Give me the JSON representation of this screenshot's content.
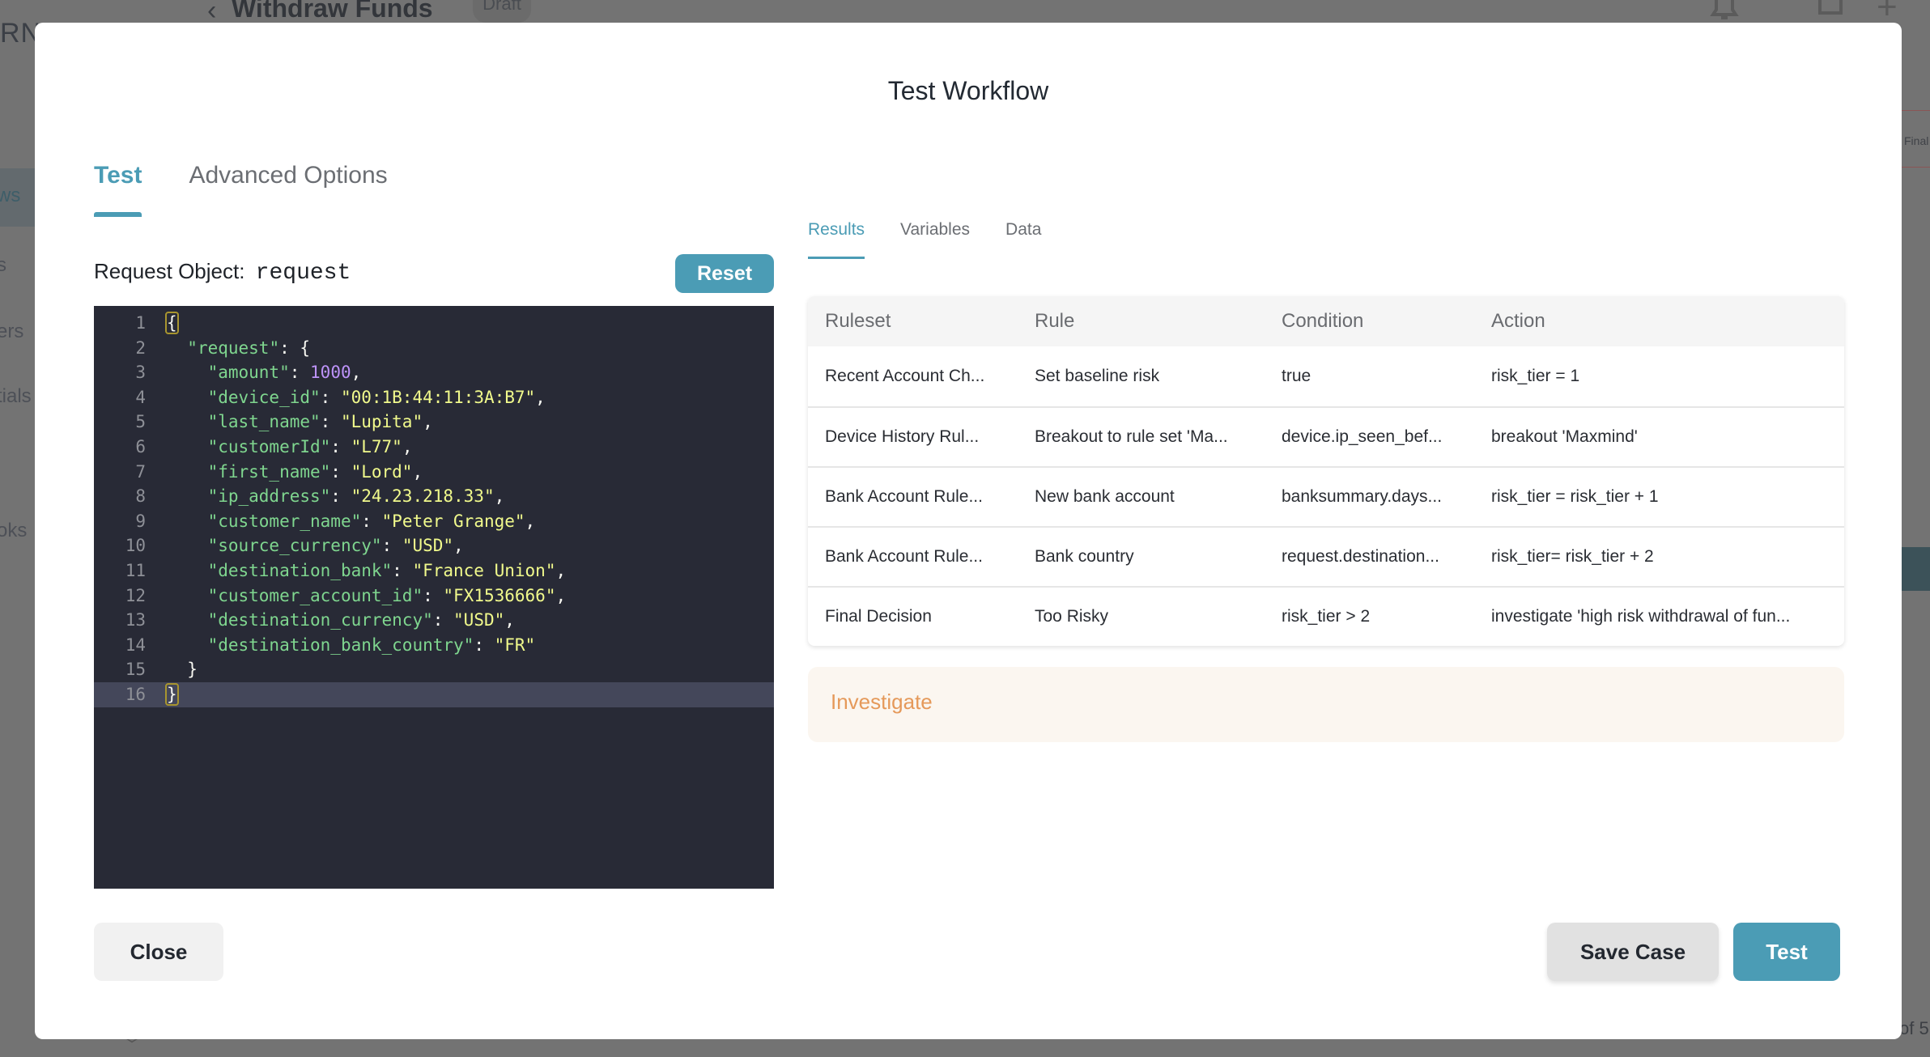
{
  "background": {
    "page_title": "Withdraw Funds",
    "status_badge": "Draft",
    "logo_fragment": "RN",
    "sidebar_fragments": [
      "ws",
      "s",
      "ers",
      "tials",
      "oks"
    ],
    "right_fragment": "Final",
    "pagination_fragment": "of 5"
  },
  "modal": {
    "title": "Test Workflow",
    "tabs": [
      {
        "label": "Test",
        "active": true
      },
      {
        "label": "Advanced Options",
        "active": false
      }
    ],
    "request": {
      "label": "Request Object:",
      "object_name": "request",
      "reset_label": "Reset"
    },
    "editor": {
      "active_line": 16,
      "lines": [
        {
          "num": "1",
          "indent": "",
          "tokens": [
            {
              "t": "punc",
              "v": "{",
              "match": true
            }
          ]
        },
        {
          "num": "2",
          "indent": "  ",
          "tokens": [
            {
              "t": "key",
              "v": "\"request\""
            },
            {
              "t": "punc",
              "v": ": {"
            }
          ]
        },
        {
          "num": "3",
          "indent": "    ",
          "tokens": [
            {
              "t": "key",
              "v": "\"amount\""
            },
            {
              "t": "punc",
              "v": ": "
            },
            {
              "t": "num",
              "v": "1000"
            },
            {
              "t": "punc",
              "v": ","
            }
          ]
        },
        {
          "num": "4",
          "indent": "    ",
          "tokens": [
            {
              "t": "key",
              "v": "\"device_id\""
            },
            {
              "t": "punc",
              "v": ": "
            },
            {
              "t": "str",
              "v": "\"00:1B:44:11:3A:B7\""
            },
            {
              "t": "punc",
              "v": ","
            }
          ]
        },
        {
          "num": "5",
          "indent": "    ",
          "tokens": [
            {
              "t": "key",
              "v": "\"last_name\""
            },
            {
              "t": "punc",
              "v": ": "
            },
            {
              "t": "str",
              "v": "\"Lupita\""
            },
            {
              "t": "punc",
              "v": ","
            }
          ]
        },
        {
          "num": "6",
          "indent": "    ",
          "tokens": [
            {
              "t": "key",
              "v": "\"customerId\""
            },
            {
              "t": "punc",
              "v": ": "
            },
            {
              "t": "str",
              "v": "\"L77\""
            },
            {
              "t": "punc",
              "v": ","
            }
          ]
        },
        {
          "num": "7",
          "indent": "    ",
          "tokens": [
            {
              "t": "key",
              "v": "\"first_name\""
            },
            {
              "t": "punc",
              "v": ": "
            },
            {
              "t": "str",
              "v": "\"Lord\""
            },
            {
              "t": "punc",
              "v": ","
            }
          ]
        },
        {
          "num": "8",
          "indent": "    ",
          "tokens": [
            {
              "t": "key",
              "v": "\"ip_address\""
            },
            {
              "t": "punc",
              "v": ": "
            },
            {
              "t": "str",
              "v": "\"24.23.218.33\""
            },
            {
              "t": "punc",
              "v": ","
            }
          ]
        },
        {
          "num": "9",
          "indent": "    ",
          "tokens": [
            {
              "t": "key",
              "v": "\"customer_name\""
            },
            {
              "t": "punc",
              "v": ": "
            },
            {
              "t": "str",
              "v": "\"Peter Grange\""
            },
            {
              "t": "punc",
              "v": ","
            }
          ]
        },
        {
          "num": "10",
          "indent": "    ",
          "tokens": [
            {
              "t": "key",
              "v": "\"source_currency\""
            },
            {
              "t": "punc",
              "v": ": "
            },
            {
              "t": "str",
              "v": "\"USD\""
            },
            {
              "t": "punc",
              "v": ","
            }
          ]
        },
        {
          "num": "11",
          "indent": "    ",
          "tokens": [
            {
              "t": "key",
              "v": "\"destination_bank\""
            },
            {
              "t": "punc",
              "v": ": "
            },
            {
              "t": "str",
              "v": "\"France Union\""
            },
            {
              "t": "punc",
              "v": ","
            }
          ]
        },
        {
          "num": "12",
          "indent": "    ",
          "tokens": [
            {
              "t": "key",
              "v": "\"customer_account_id\""
            },
            {
              "t": "punc",
              "v": ": "
            },
            {
              "t": "str",
              "v": "\"FX1536666\""
            },
            {
              "t": "punc",
              "v": ","
            }
          ]
        },
        {
          "num": "13",
          "indent": "    ",
          "tokens": [
            {
              "t": "key",
              "v": "\"destination_currency\""
            },
            {
              "t": "punc",
              "v": ": "
            },
            {
              "t": "str",
              "v": "\"USD\""
            },
            {
              "t": "punc",
              "v": ","
            }
          ]
        },
        {
          "num": "14",
          "indent": "    ",
          "tokens": [
            {
              "t": "key",
              "v": "\"destination_bank_country\""
            },
            {
              "t": "punc",
              "v": ": "
            },
            {
              "t": "str",
              "v": "\"FR\""
            }
          ]
        },
        {
          "num": "15",
          "indent": "  ",
          "tokens": [
            {
              "t": "punc",
              "v": "}"
            }
          ]
        },
        {
          "num": "16",
          "indent": "",
          "tokens": [
            {
              "t": "punc",
              "v": "}",
              "match": true
            }
          ]
        }
      ]
    },
    "results": {
      "tabs": [
        {
          "label": "Results",
          "active": true
        },
        {
          "label": "Variables",
          "active": false
        },
        {
          "label": "Data",
          "active": false
        }
      ],
      "columns": [
        "Ruleset",
        "Rule",
        "Condition",
        "Action"
      ],
      "rows": [
        [
          "Recent Account Ch...",
          "Set baseline risk",
          "true",
          "risk_tier = 1"
        ],
        [
          "Device History Rul...",
          "Breakout to rule set 'Ma...",
          "device.ip_seen_bef...",
          "breakout 'Maxmind'"
        ],
        [
          "Bank Account Rule...",
          "New bank account",
          "banksummary.days...",
          "risk_tier = risk_tier + 1"
        ],
        [
          "Bank Account Rule...",
          "Bank country",
          "request.destination...",
          "risk_tier= risk_tier + 2"
        ],
        [
          "Final Decision",
          "Too Risky",
          "risk_tier > 2",
          "investigate 'high risk withdrawal of fun..."
        ]
      ],
      "outcome": "Investigate",
      "outcome_color": "#e5995a"
    },
    "footer": {
      "close_label": "Close",
      "save_case_label": "Save Case",
      "test_label": "Test"
    }
  },
  "colors": {
    "accent": "#4b9cb5",
    "editor_bg": "#282a36",
    "overlay": "#737373"
  }
}
